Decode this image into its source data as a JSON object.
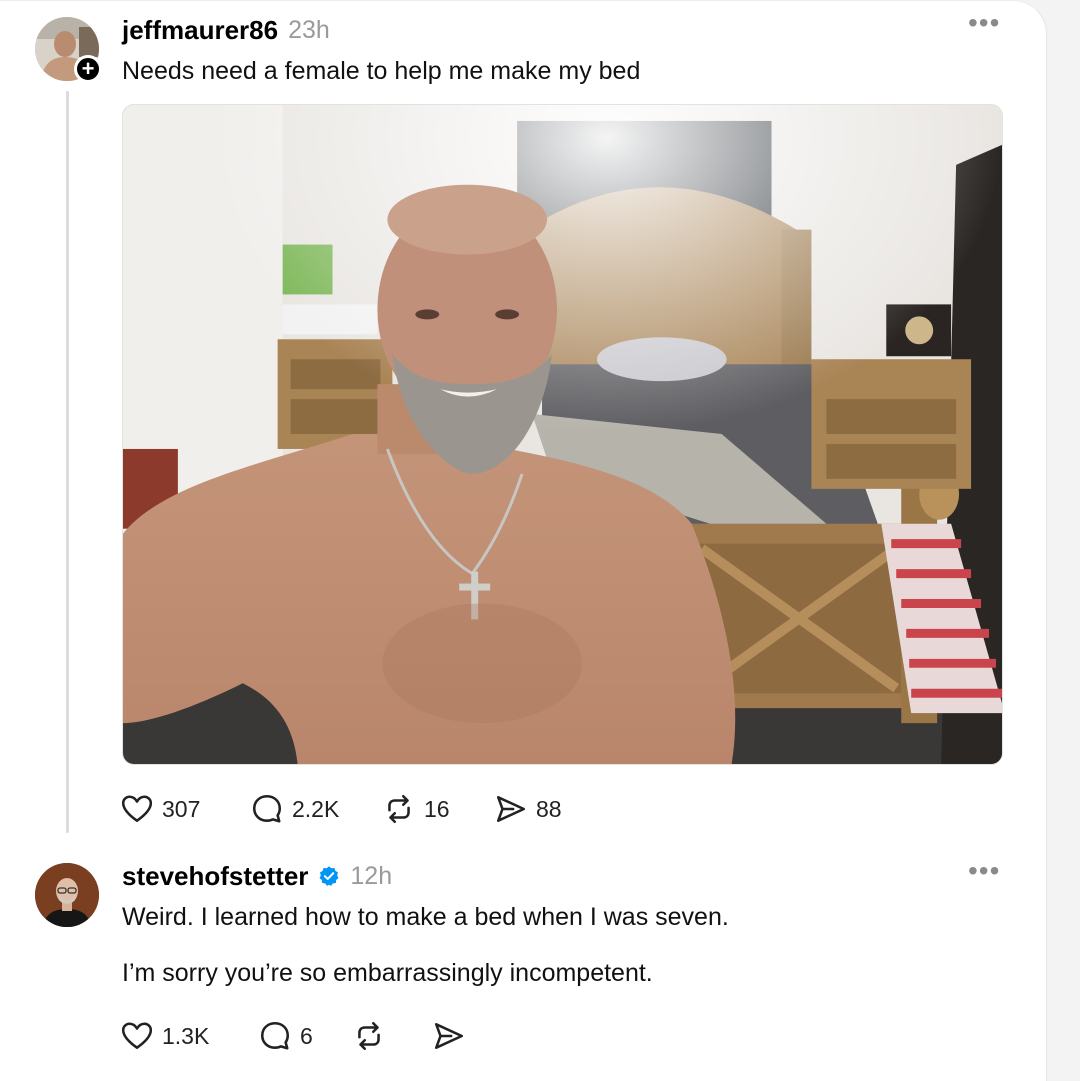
{
  "post": {
    "username": "jeffmaurer86",
    "time": "23h",
    "text": "Needs need a female to help me make my bed",
    "follow_glyph": "+",
    "more_glyph": "•••",
    "stats": {
      "likes": "307",
      "replies": "2.2K",
      "reposts": "16",
      "shares": "88"
    }
  },
  "reply": {
    "username": "stevehofstetter",
    "verified": true,
    "time": "12h",
    "line1": "Weird. I learned how to make a bed when I was seven.",
    "line2": "I’m sorry you’re so embarrassingly incompetent.",
    "more_glyph": "•••",
    "stats": {
      "likes": "1.3K",
      "replies": "6"
    }
  },
  "icons": {
    "like": "heart-icon",
    "reply": "comment-bubble-icon",
    "repost": "repost-arrows-icon",
    "share": "send-icon",
    "verified": "verified-badge-icon",
    "more": "more-dots-icon"
  },
  "colors": {
    "verified_blue": "#0095f6",
    "muted_text": "#9a9a9a"
  }
}
